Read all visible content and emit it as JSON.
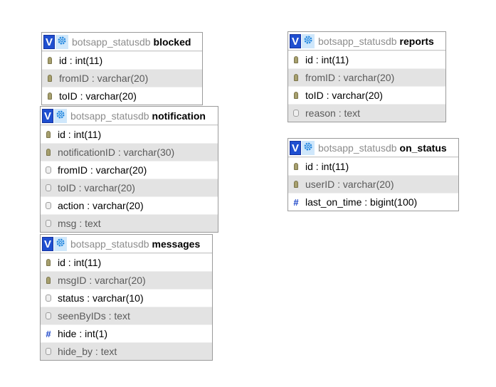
{
  "tables": {
    "blocked": {
      "db": "botsapp_statusdb",
      "name": "blocked",
      "columns": [
        {
          "text": "id : int(11)",
          "icon": "key-icon"
        },
        {
          "text": "fromID : varchar(20)",
          "icon": "key-icon"
        },
        {
          "text": "toID : varchar(20)",
          "icon": "key-icon"
        }
      ]
    },
    "notification": {
      "db": "botsapp_statusdb",
      "name": "notification",
      "columns": [
        {
          "text": "id : int(11)",
          "icon": "key-icon"
        },
        {
          "text": "notificationID : varchar(30)",
          "icon": "key-icon"
        },
        {
          "text": "fromID : varchar(20)",
          "icon": "column-icon"
        },
        {
          "text": "toID : varchar(20)",
          "icon": "column-icon"
        },
        {
          "text": "action : varchar(20)",
          "icon": "column-icon"
        },
        {
          "text": "msg : text",
          "icon": "column-icon"
        }
      ]
    },
    "messages": {
      "db": "botsapp_statusdb",
      "name": "messages",
      "columns": [
        {
          "text": "id : int(11)",
          "icon": "key-icon"
        },
        {
          "text": "msgID : varchar(20)",
          "icon": "key-icon"
        },
        {
          "text": "status : varchar(10)",
          "icon": "column-icon"
        },
        {
          "text": "seenByIDs : text",
          "icon": "column-icon"
        },
        {
          "text": "hide : int(1)",
          "icon": "numeric-icon"
        },
        {
          "text": "hide_by : text",
          "icon": "column-icon"
        }
      ]
    },
    "reports": {
      "db": "botsapp_statusdb",
      "name": "reports",
      "columns": [
        {
          "text": "id : int(11)",
          "icon": "key-icon"
        },
        {
          "text": "fromID : varchar(20)",
          "icon": "key-icon"
        },
        {
          "text": "toID : varchar(20)",
          "icon": "key-icon"
        },
        {
          "text": "reason : text",
          "icon": "column-icon"
        }
      ]
    },
    "on_status": {
      "db": "botsapp_statusdb",
      "name": "on_status",
      "columns": [
        {
          "text": "id : int(11)",
          "icon": "key-icon"
        },
        {
          "text": "userID : varchar(20)",
          "icon": "key-icon"
        },
        {
          "text": "last_on_time : bigint(100)",
          "icon": "numeric-icon"
        }
      ]
    }
  },
  "toggle_label": "V"
}
